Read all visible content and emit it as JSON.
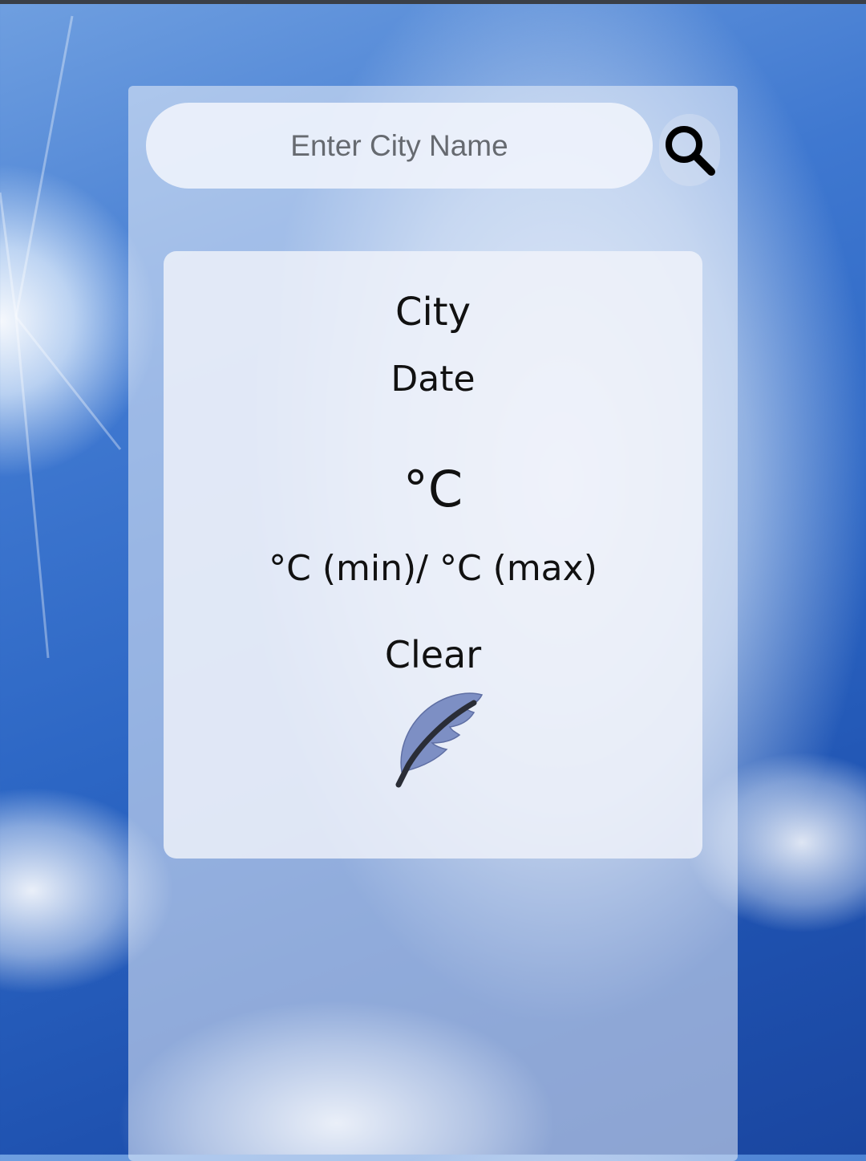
{
  "search": {
    "placeholder": "Enter City Name",
    "value": ""
  },
  "icons": {
    "search": "search-icon",
    "weather": "feather-icon"
  },
  "weather": {
    "city": "City",
    "date": "Date",
    "temperature": "°C",
    "min_max": "°C (min)/ °C (max)",
    "condition": "Clear"
  },
  "colors": {
    "sky_dark": "#1f52b0",
    "sky_light": "#6f9fe0",
    "feather_fill": "#7d8fc4",
    "feather_shaft": "#2a2d36",
    "text": "#111111"
  }
}
